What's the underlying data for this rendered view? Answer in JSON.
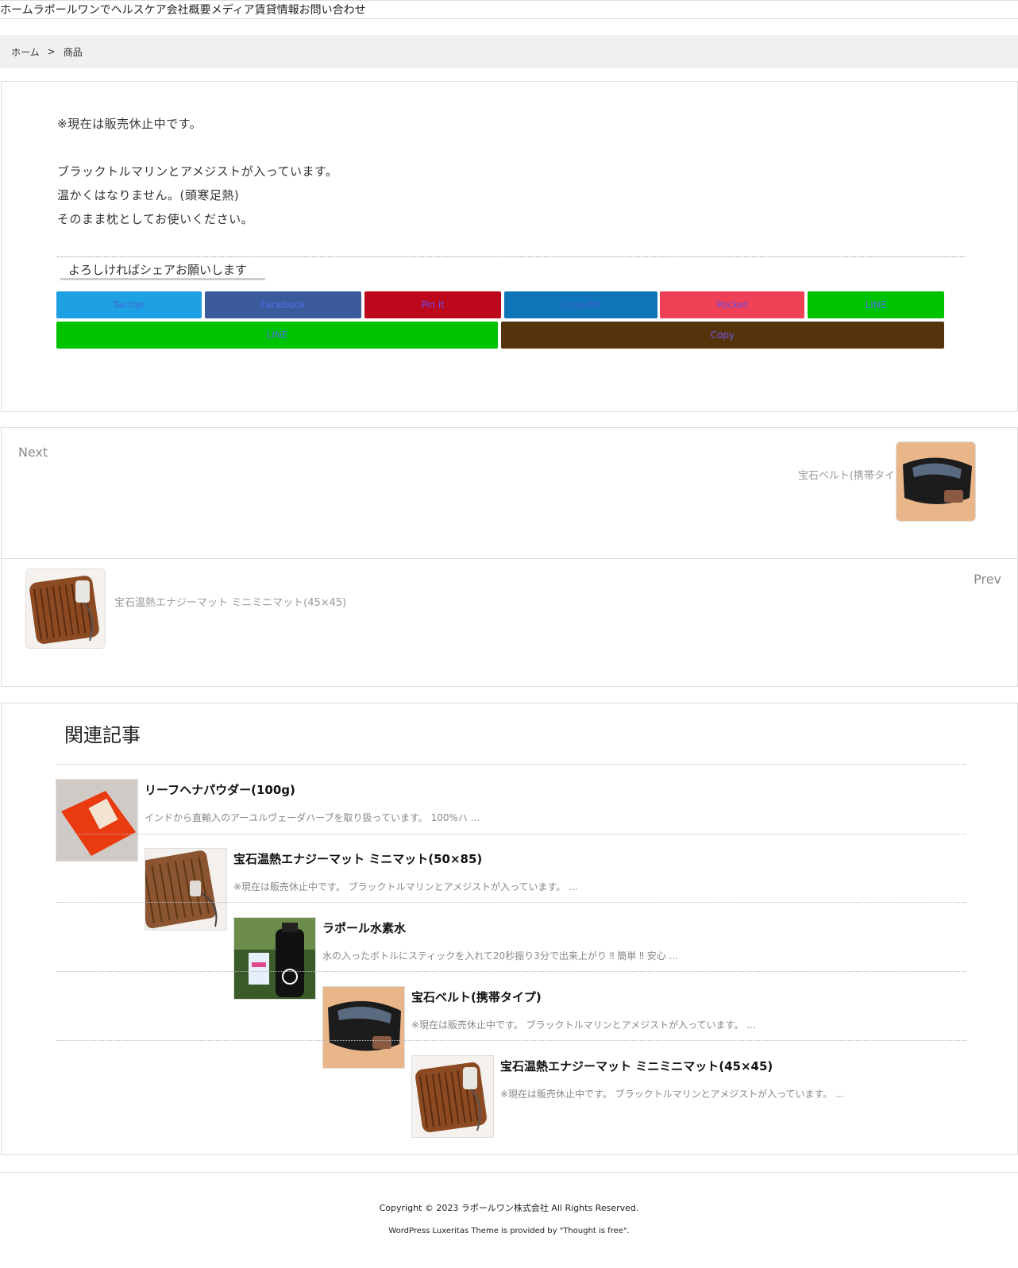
{
  "nav": {
    "items": [
      "ホーム",
      "ラポールワンで",
      "ヘルスケア",
      "会社概要",
      "メディア",
      "賃貸情報",
      "お問い合わせ"
    ]
  },
  "breadcrumb": {
    "home": "ホーム",
    "separator": ">",
    "current": "商品"
  },
  "post": {
    "lines": [
      "※現在は販売休止中です。",
      "ブラックトルマリンとアメジストが入っています。",
      "温かくはなりません。(頭寒足熱)",
      "そのまま枕としてお使いください。"
    ]
  },
  "share": {
    "title": "よろしければシェアお願いします",
    "buttons": [
      {
        "label": "Twitter",
        "bg": "#1da1e2",
        "fg": "#3d6bd8"
      },
      {
        "label": "Facebook",
        "bg": "#3b5a9a",
        "fg": "#4f6ee8"
      },
      {
        "label": "Pin it",
        "bg": "#bd081c",
        "fg": "#6b4cf0"
      },
      {
        "label": "LinkedIn",
        "bg": "#0e76b8",
        "fg": "#3f5fd0"
      },
      {
        "label": "Pocket",
        "bg": "#ef4056",
        "fg": "#6c4de0"
      },
      {
        "label": "LINE",
        "bg": "#00c300",
        "fg": "#4a6ae0"
      },
      {
        "label": "LINE",
        "bg": "#00c300",
        "fg": "#4a6ae0"
      },
      {
        "label": "Copy",
        "bg": "#55330b",
        "fg": "#6a5ae8"
      }
    ]
  },
  "postnav": {
    "next_label": "Next",
    "next_title": "宝石ベルト(携帯タイプ)",
    "prev_label": "Prev",
    "prev_title": "宝石温熱エナジーマット ミニミニマット(45×45)"
  },
  "related": {
    "heading": "関連記事",
    "items": [
      {
        "title": "リーフヘナパウダー(100g)",
        "excerpt": "インドから直輸入のアーユルヴェーダハーブを取り扱っています。 100%ハ ...",
        "icon": "henna-package-image"
      },
      {
        "title": "宝石温熱エナジーマット ミニマット(50×85)",
        "excerpt": "※現在は販売休止中です。 ブラックトルマリンとアメジストが入っています。 ...",
        "icon": "energy-mat-image"
      },
      {
        "title": "ラポール水素水",
        "excerpt": "水の入ったボトルにスティックを入れて20秒振り3分で出来上がり ‼ 簡単 ‼ 安心 ...",
        "icon": "hydrogen-water-bottle-image"
      },
      {
        "title": "宝石ベルト(携帯タイプ)",
        "excerpt": "※現在は販売休止中です。 ブラックトルマリンとアメジストが入っています。 ...",
        "icon": "stone-belt-image"
      },
      {
        "title": "宝石温熱エナジーマット ミニミニマット(45×45)",
        "excerpt": "※現在は販売休止中です。 ブラックトルマリンとアメジストが入っています。 ...",
        "icon": "mini-mat-image"
      }
    ]
  },
  "footer": {
    "copyright": "Copyright © 2023 ラポールワン株式会社 All Rights Reserved.",
    "credit": "WordPress Luxeritas Theme is provided by \"Thought is free\"."
  }
}
